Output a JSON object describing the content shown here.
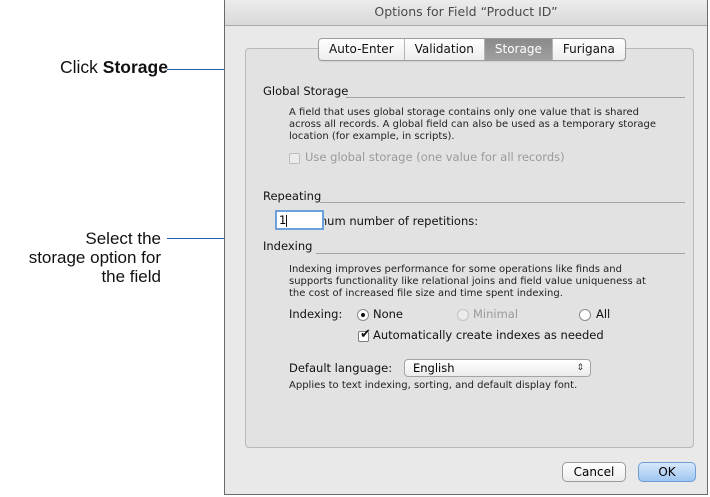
{
  "callouts": {
    "click_prefix": "Click ",
    "click_target": "Storage",
    "select_line1": "Select the",
    "select_line2": "storage option for",
    "select_line3": "the field"
  },
  "dialog": {
    "title": "Options for Field “Product ID”",
    "tabs": [
      {
        "label": "Auto-Enter",
        "active": false
      },
      {
        "label": "Validation",
        "active": false
      },
      {
        "label": "Storage",
        "active": true
      },
      {
        "label": "Furigana",
        "active": false
      }
    ],
    "global_storage": {
      "title": "Global Storage",
      "desc_line1": "A field that uses global storage contains only one value that is shared",
      "desc_line2": "across all records.  A global field can also be used as a temporary storage",
      "desc_line3": "location (for example, in scripts).",
      "checkbox_label": "Use global storage (one value for all records)",
      "checked": false,
      "enabled": false
    },
    "repeating": {
      "title": "Repeating",
      "max_label": "Maximum number of repetitions:",
      "max_value": "1"
    },
    "indexing": {
      "title": "Indexing",
      "desc_line1": "Indexing improves performance for some operations like finds and",
      "desc_line2": "supports functionality like relational joins and field value uniqueness at",
      "desc_line3": "the cost of increased file size and time spent indexing.",
      "label": "Indexing:",
      "options": {
        "none": "None",
        "minimal": "Minimal",
        "all": "All"
      },
      "selected": "None",
      "auto_label": "Automatically create indexes as needed",
      "auto_checked": true
    },
    "language": {
      "label": "Default language:",
      "value": "English",
      "note": "Applies to text indexing, sorting, and default display font."
    },
    "buttons": {
      "cancel": "Cancel",
      "ok": "OK"
    }
  },
  "colors": {
    "callout_line": "#1f5fa8",
    "default_button": "#9fc5f1",
    "focus_ring": "#6da1db"
  },
  "icons": {
    "select_arrow": "up-down-chevron-icon",
    "checkmark": "checkmark-icon"
  }
}
